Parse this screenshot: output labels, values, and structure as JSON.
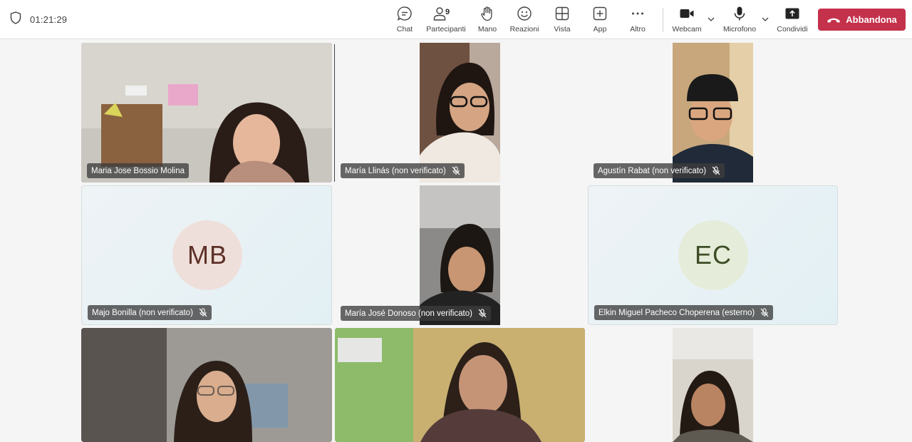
{
  "meeting": {
    "timer": "01:21:29"
  },
  "toolbar": {
    "chat": "Chat",
    "participants": "Partecipanti",
    "participants_count": "9",
    "hand": "Mano",
    "reactions": "Reazioni",
    "view": "Vista",
    "apps": "App",
    "more": "Altro",
    "camera": "Webcam",
    "mic": "Microfono",
    "share": "Condividi",
    "leave": "Abbandona"
  },
  "participants": [
    {
      "name": "Maria Jose Bossio Molina"
    },
    {
      "name": "María Llinás (non verificato)"
    },
    {
      "name": "Agustín Rabat (non verificato)"
    },
    {
      "name": "Majo Bonilla (non verificato)",
      "initials": "MB"
    },
    {
      "name": "María José Donoso (non verificato)"
    },
    {
      "name": "Elkin Miguel Pacheco Choperena (esterno)",
      "initials": "EC"
    }
  ],
  "colors": {
    "leave": "#c4314b",
    "topbar": "#ffffff",
    "stage": "#f5f5f5"
  },
  "icons": [
    "shield-icon",
    "chat-icon",
    "people-icon",
    "hand-icon",
    "emoji-icon",
    "grid-icon",
    "add-icon",
    "more-icon",
    "camera-icon",
    "mic-icon",
    "share-icon",
    "phone-hangup-icon",
    "mic-off-icon",
    "chevron-down-icon"
  ]
}
